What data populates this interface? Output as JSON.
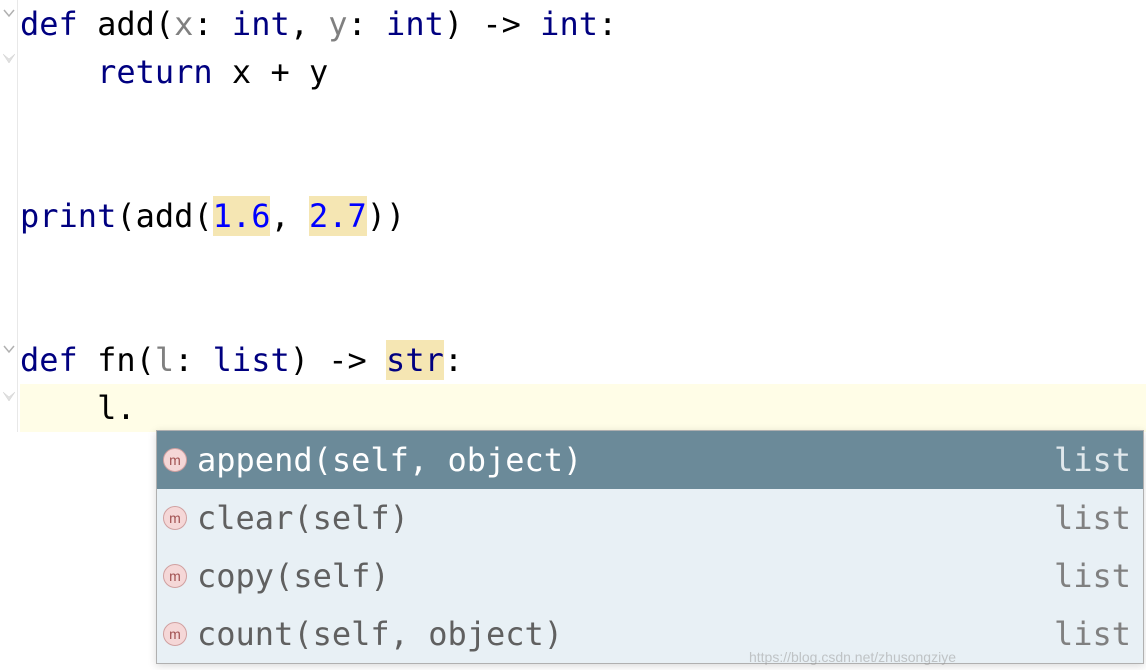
{
  "code": {
    "line1": {
      "def": "def",
      "name": "add",
      "open": "(",
      "p1": "x",
      "colon1": ": ",
      "t1": "int",
      "comma": ", ",
      "p2": "y",
      "colon2": ": ",
      "t2": "int",
      "close": ")",
      "arrow": " -> ",
      "ret": "int",
      "end": ":"
    },
    "line2": {
      "indent": "    ",
      "ret_kw": "return",
      "expr": " x + y"
    },
    "line4": {
      "print": "print",
      "open": "(",
      "call": "add",
      "open2": "(",
      "n1": "1.6",
      "comma": ", ",
      "n2": "2.7",
      "close": "))"
    },
    "line6": {
      "def": "def",
      "name": "fn",
      "open": "(",
      "p1": "l",
      "colon1": ": ",
      "t1": "list",
      "close": ")",
      "arrow": " -> ",
      "ret": "str",
      "end": ":"
    },
    "line7": {
      "indent": "    ",
      "expr": "l."
    }
  },
  "completions": [
    {
      "kind": "m",
      "sig": "append(self, object)",
      "origin": "list",
      "selected": true
    },
    {
      "kind": "m",
      "sig": "clear(self)",
      "origin": "list",
      "selected": false
    },
    {
      "kind": "m",
      "sig": "copy(self)",
      "origin": "list",
      "selected": false
    },
    {
      "kind": "m",
      "sig": "count(self, object)",
      "origin": "list",
      "selected": false
    }
  ],
  "watermark": "https://blog.csdn.net/zhusongziye"
}
